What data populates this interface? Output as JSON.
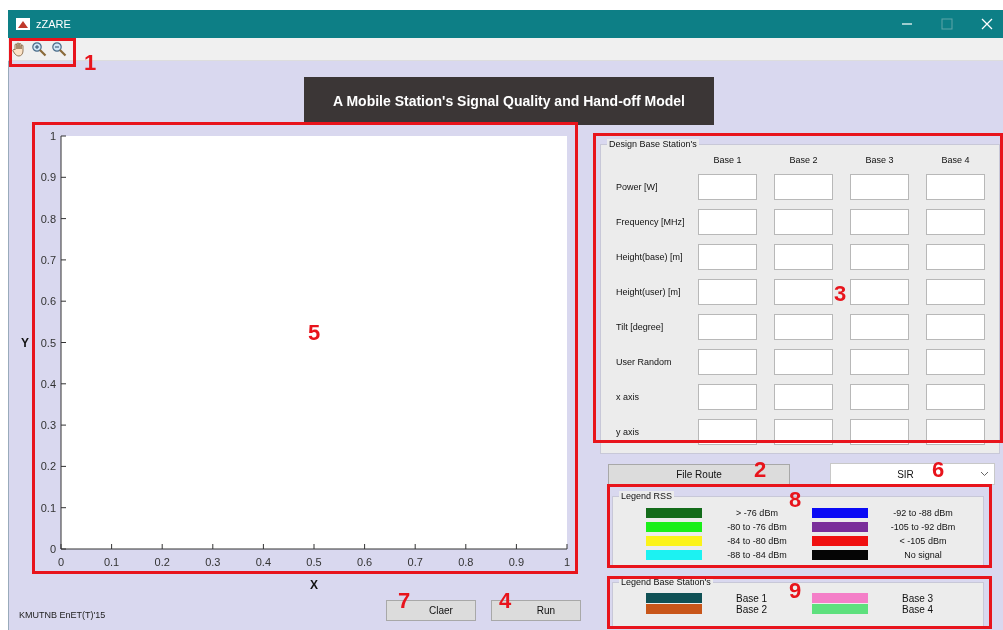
{
  "window": {
    "title": "zZARE"
  },
  "toolbar": {
    "tools": [
      {
        "kind": "pan"
      },
      {
        "kind": "zoom-in"
      },
      {
        "kind": "zoom-out"
      }
    ]
  },
  "banner": "A Mobile Station's Signal Quality and Hand-off Model",
  "plot": {
    "chart_data": {
      "type": "line",
      "xlabel": "X",
      "ylabel": "Y",
      "xlim": [
        0,
        1
      ],
      "ylim": [
        0,
        1
      ],
      "xticks": [
        0,
        0.1,
        0.2,
        0.3,
        0.4,
        0.5,
        0.6,
        0.7,
        0.8,
        0.9,
        1
      ],
      "yticks": [
        0,
        0.1,
        0.2,
        0.3,
        0.4,
        0.5,
        0.6,
        0.7,
        0.8,
        0.9,
        1
      ]
    }
  },
  "design": {
    "title": "Design Base  Station's",
    "columns": [
      "Base 1",
      "Base 2",
      "Base 3",
      "Base 4"
    ],
    "rows": [
      {
        "label": "Power [W]"
      },
      {
        "label": "Frequency [MHz]"
      },
      {
        "label": "Height(base) [m]"
      },
      {
        "label": "Height(user) [m]"
      },
      {
        "label": "Tilt [degree]"
      },
      {
        "label": "User Random"
      },
      {
        "label": "x axis"
      },
      {
        "label": "y axis"
      }
    ]
  },
  "file_route_button": "File Route",
  "metric_dropdown": {
    "value": "SIR"
  },
  "legend_rss": {
    "title": "Legend RSS",
    "items": [
      {
        "label": "> -76 dBm",
        "color": "#136b1a"
      },
      {
        "label": "-80 to -76 dBm",
        "color": "#1aef1a"
      },
      {
        "label": "-84 to -80 dBm",
        "color": "#fbf31a"
      },
      {
        "label": "-88 to -84 dBm",
        "color": "#1cf2f2"
      },
      {
        "label": "-92 to -88 dBm",
        "color": "#0a0af5"
      },
      {
        "label": "-105 to -92 dBm",
        "color": "#7a2e9a"
      },
      {
        "label": "< -105 dBm",
        "color": "#f01010"
      },
      {
        "label": "No signal",
        "color": "#050505"
      }
    ]
  },
  "legend_base": {
    "title": "Legend Base Station's",
    "items": [
      {
        "label": "Base 1",
        "color": "#0f5055"
      },
      {
        "label": "Base 2",
        "color": "#c8561a"
      },
      {
        "label": "Base 3",
        "color": "#f47fc8"
      },
      {
        "label": "Base 4",
        "color": "#5ee07e"
      }
    ]
  },
  "credit": "KMUTNB EnET(T)'15",
  "buttons": [
    "Claer",
    "Run"
  ],
  "annotations": [
    {
      "label": "1"
    },
    {
      "label": "5"
    },
    {
      "label": "3"
    },
    {
      "label": "2"
    },
    {
      "label": "6"
    },
    {
      "label": "8"
    },
    {
      "label": "9"
    },
    {
      "label": "7"
    },
    {
      "label": "4"
    }
  ]
}
